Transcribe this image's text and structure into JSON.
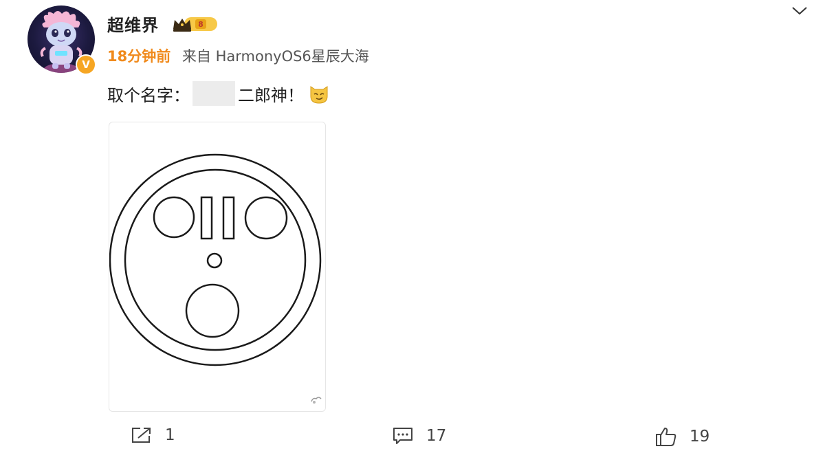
{
  "post": {
    "username": "超维界",
    "vip_level": "8",
    "time": "18分钟前",
    "source": "来自 HarmonyOS6星辰大海",
    "text_before": "取个名字：",
    "text_after": "二郎神！",
    "emoji": "smirk-cat-emoji",
    "image_alt_icon": "face-drawing"
  },
  "actions": {
    "repost_count": "1",
    "comment_count": "17",
    "like_count": "19"
  },
  "colors": {
    "time": "#f08a1c",
    "badge": "#f6a623",
    "text": "#222222",
    "muted": "#555555"
  }
}
